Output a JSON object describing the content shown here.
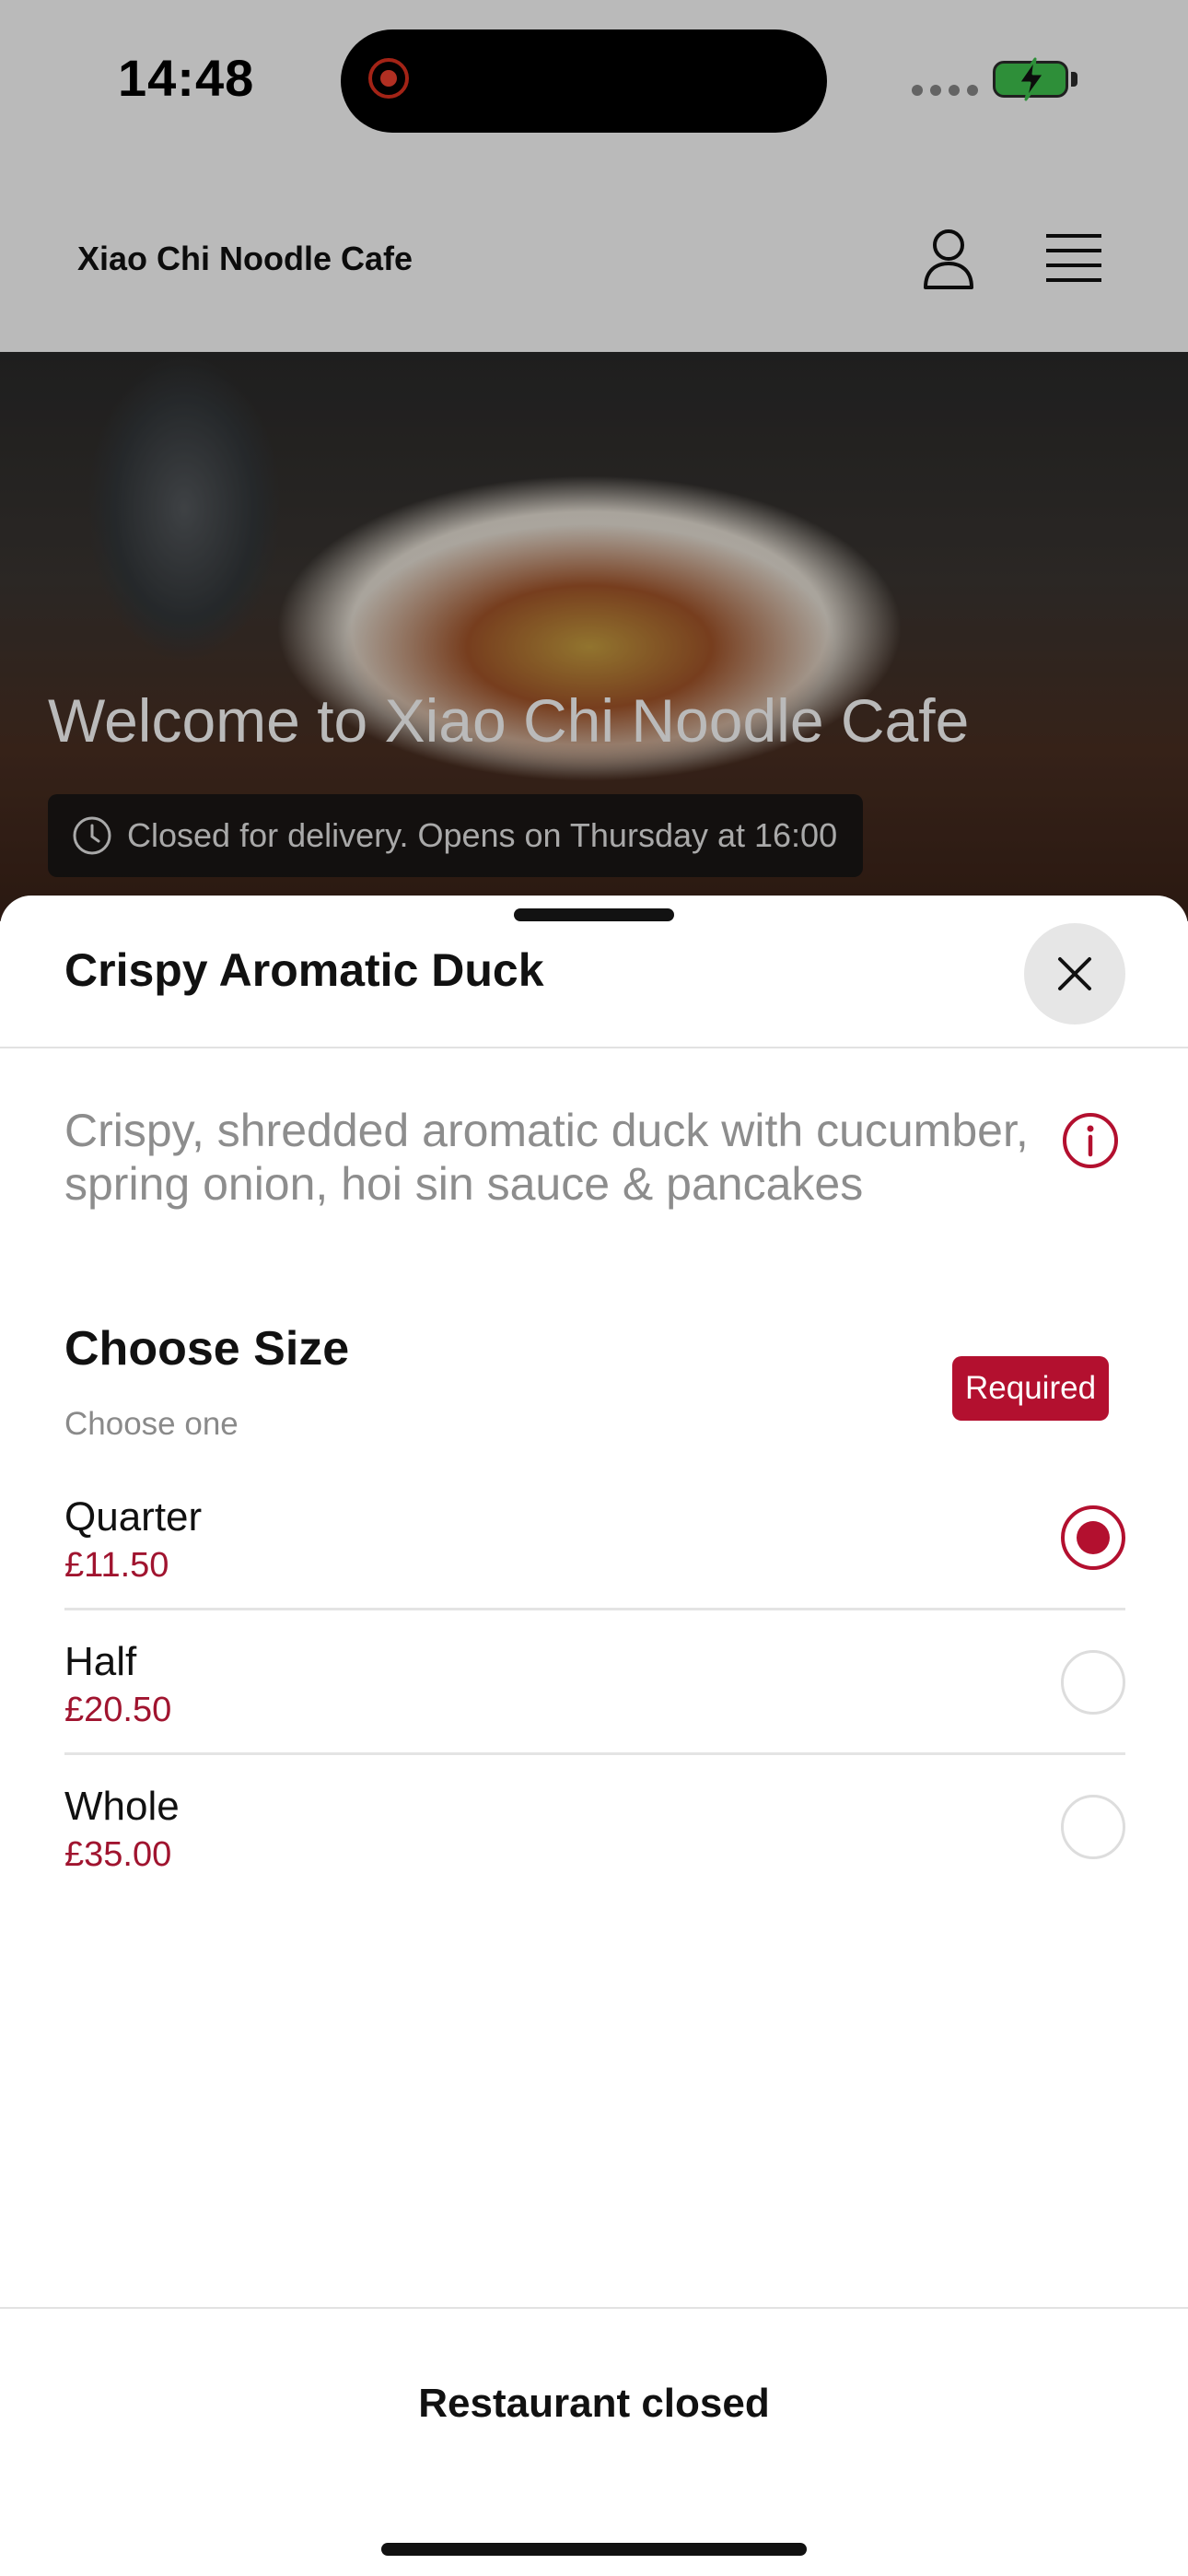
{
  "status_bar": {
    "time": "14:48",
    "recording_icon": "screen-recording-icon",
    "battery_icon": "battery-charging-icon",
    "battery_color": "#3fc54f"
  },
  "header": {
    "title": "Xiao Chi Noodle Cafe",
    "account_icon": "user-icon",
    "menu_icon": "hamburger-menu-icon"
  },
  "hero": {
    "title": "Welcome to Xiao Chi Noodle Cafe",
    "status_icon": "clock-icon",
    "status_text": "Closed for delivery. Opens on Thursday at 16:00"
  },
  "sheet": {
    "title": "Crispy Aromatic Duck",
    "close_icon": "close-icon",
    "description": "Crispy, shredded aromatic duck with cucumber, spring onion, hoi sin sauce & pancakes",
    "info_icon": "info-icon",
    "section": {
      "title": "Choose Size",
      "subtitle": "Choose one",
      "badge": "Required"
    },
    "options": [
      {
        "name": "Quarter",
        "price": "£11.50",
        "selected": true
      },
      {
        "name": "Half",
        "price": "£20.50",
        "selected": false
      },
      {
        "name": "Whole",
        "price": "£35.00",
        "selected": false
      }
    ],
    "footer_label": "Restaurant closed"
  },
  "colors": {
    "accent": "#b3102f",
    "price": "#a0142f",
    "text_primary": "#111111",
    "text_secondary": "#8d8d8d"
  }
}
